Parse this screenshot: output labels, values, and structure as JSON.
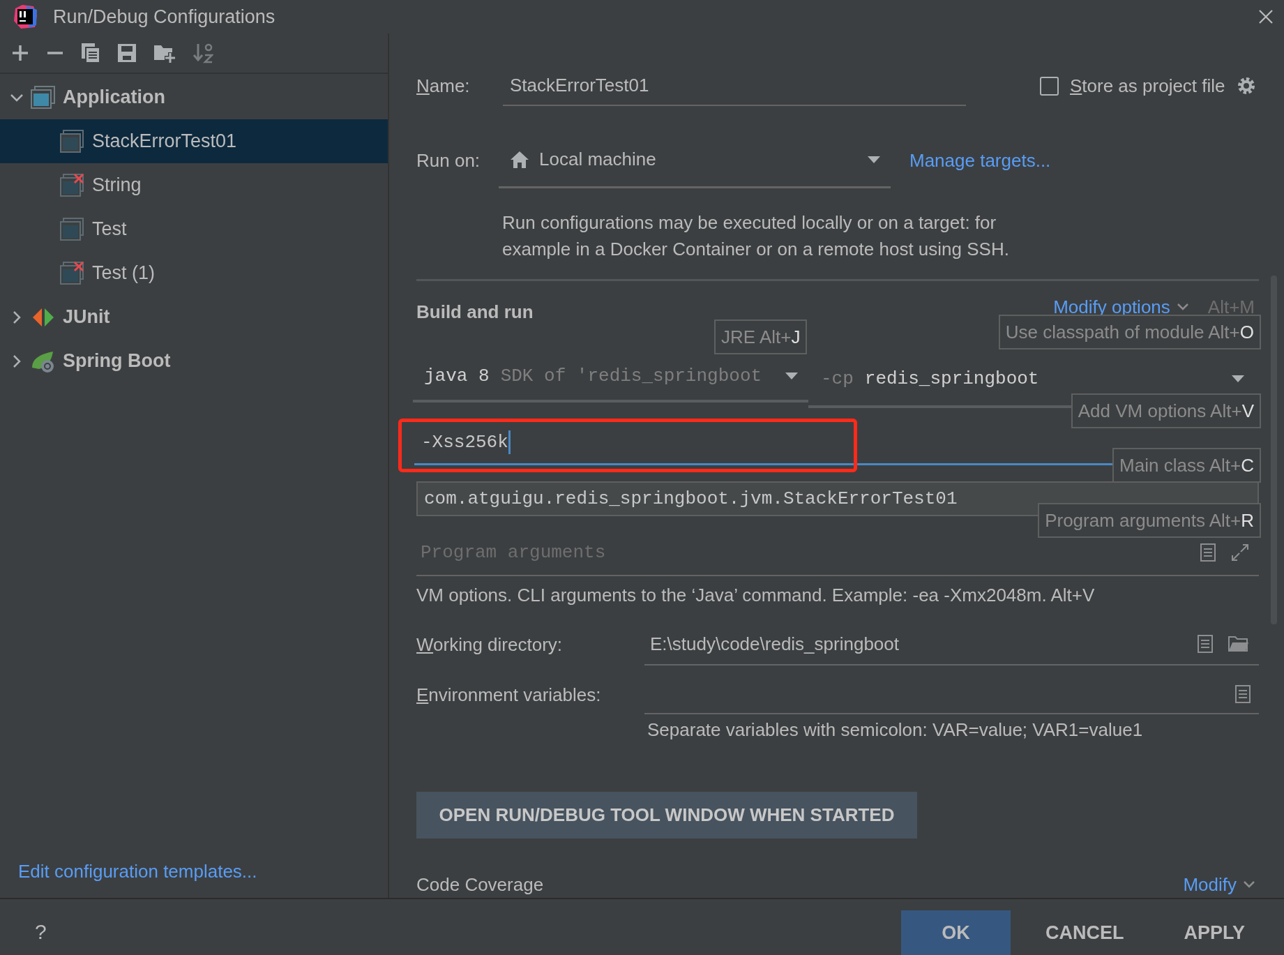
{
  "window": {
    "title": "Run/Debug Configurations"
  },
  "tree": [
    {
      "label": "Application",
      "kind": "application",
      "expanded": true,
      "children": [
        {
          "label": "StackErrorTest01",
          "selected": true,
          "error": false
        },
        {
          "label": "String",
          "selected": false,
          "error": true
        },
        {
          "label": "Test",
          "selected": false,
          "error": false
        },
        {
          "label": "Test (1)",
          "selected": false,
          "error": true
        }
      ]
    },
    {
      "label": "JUnit",
      "kind": "junit",
      "expanded": false
    },
    {
      "label": "Spring Boot",
      "kind": "spring",
      "expanded": false
    }
  ],
  "edit_templates_link": "Edit configuration templates...",
  "help": "?",
  "name_field": {
    "label": "Name:",
    "mnemonic": true,
    "value": "StackErrorTest01"
  },
  "store_as_project_file": {
    "label": "Store as project file",
    "mnemonic": true,
    "checked": false
  },
  "run_on": {
    "label": "Run on:",
    "value": "Local machine",
    "link": "Manage targets...",
    "description": "Run configurations may be executed locally or on a target: for example in a Docker Container or on a remote host using SSH."
  },
  "build_and_run": {
    "title": "Build and run",
    "modify_options": "Modify options",
    "modify_shortcut": "Alt+M",
    "jre": {
      "value": "java 8",
      "sdk": "SDK of 'redis_springboot",
      "shortcut_hint": {
        "text": "JRE Alt+",
        "key": "J"
      }
    },
    "classpath": {
      "prefix": "-cp",
      "value": "redis_springboot",
      "shortcut_hint": {
        "text": "Use classpath of module Alt+",
        "key": "O"
      }
    },
    "vm_options": {
      "value": "-Xss256k",
      "shortcut_hint": {
        "text": "Add VM options Alt+",
        "key": "V"
      }
    },
    "main_class": {
      "value": "com.atguigu.redis_springboot.jvm.StackErrorTest01",
      "shortcut_hint": {
        "text": "Main class Alt+",
        "key": "C"
      }
    },
    "program_arguments": {
      "placeholder": "Program arguments",
      "shortcut_hint": {
        "text": "Program arguments Alt+",
        "key": "R"
      }
    },
    "help": "VM options. CLI arguments to the ‘Java’ command. Example: -ea -Xmx2048m. Alt+V"
  },
  "working_directory": {
    "label": "Working directory:",
    "mnemonic": true,
    "value": "E:\\study\\code\\redis_springboot"
  },
  "environment_variables": {
    "label": "Environment variables:",
    "mnemonic": true,
    "hint": "Separate variables with semicolon: VAR=value; VAR1=value1"
  },
  "open_tool_window_button": "OPEN RUN/DEBUG TOOL WINDOW WHEN STARTED",
  "code_coverage": {
    "title": "Code Coverage",
    "modify": "Modify"
  },
  "buttons": [
    {
      "label": "OK",
      "default": true
    },
    {
      "label": "CANCEL",
      "default": false
    },
    {
      "label": "APPLY",
      "default": false
    }
  ]
}
